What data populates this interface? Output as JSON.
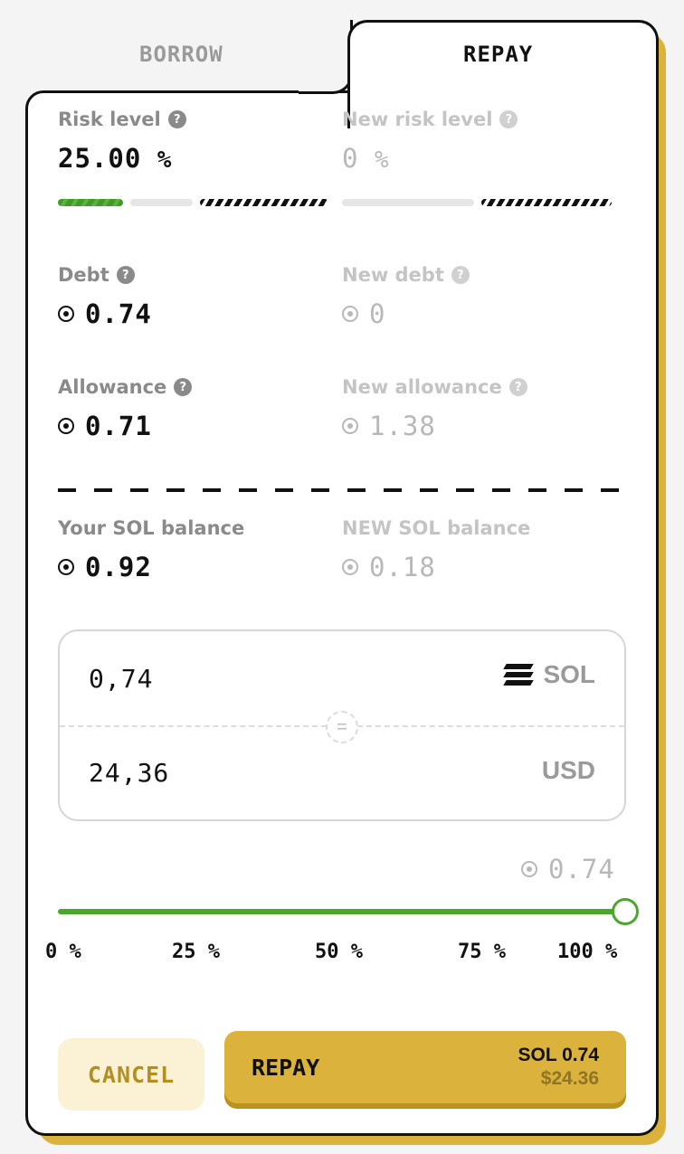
{
  "tabs": {
    "borrow": "BORROW",
    "repay": "REPAY"
  },
  "risk": {
    "label": "Risk level",
    "value": "25.00",
    "unit": "%",
    "new_label": "New risk level",
    "new_value": "0",
    "new_unit": "%"
  },
  "debt": {
    "label": "Debt",
    "value": "0.74",
    "new_label": "New debt",
    "new_value": "0"
  },
  "allowance": {
    "label": "Allowance",
    "value": "0.71",
    "new_label": "New allowance",
    "new_value": "1.38"
  },
  "balance": {
    "label": "Your SOL balance",
    "value": "0.92",
    "new_label": "NEW SOL balance",
    "new_value": "0.18"
  },
  "converter": {
    "sol_amount": "0,74",
    "sol_currency": "SOL",
    "usd_amount": "24,36",
    "usd_currency": "USD",
    "equals": "="
  },
  "slider": {
    "value": "0.74",
    "percent": 100,
    "ticks": [
      "0 %",
      "25 %",
      "50 %",
      "75 %",
      "100 %"
    ]
  },
  "buttons": {
    "cancel": "CANCEL",
    "repay": "REPAY",
    "repay_sol": "SOL 0.74",
    "repay_usd": "$24.36"
  },
  "help_glyph": "?",
  "colors": {
    "accent": "#dbb33c",
    "success": "#4aa72c",
    "muted": "#8a8a8a"
  }
}
